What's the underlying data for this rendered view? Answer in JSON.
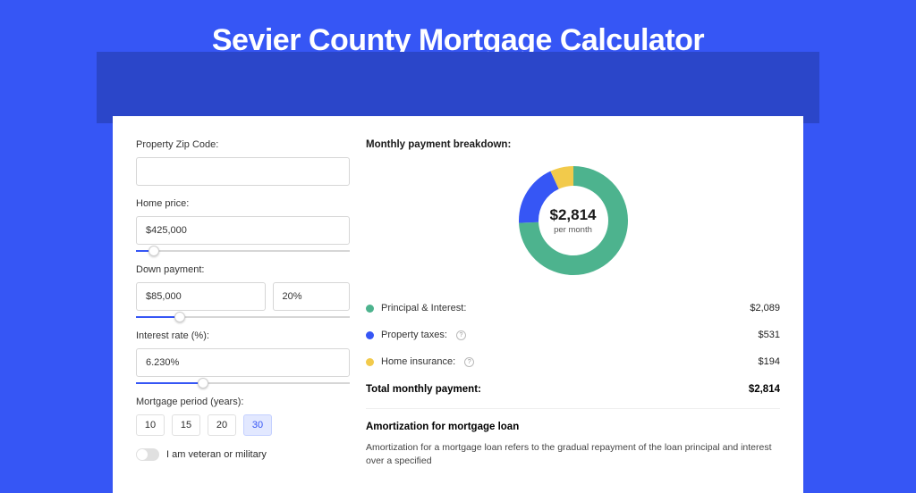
{
  "title": "Sevier County Mortgage Calculator",
  "form": {
    "zip_label": "Property Zip Code:",
    "zip_value": "",
    "price_label": "Home price:",
    "price_value": "$425,000",
    "dp_label": "Down payment:",
    "dp_amount": "$85,000",
    "dp_pct": "20%",
    "rate_label": "Interest rate (%):",
    "rate_value": "6.230%",
    "period_label": "Mortgage period (years):",
    "periods": [
      "10",
      "15",
      "20",
      "30"
    ],
    "period_selected": "30",
    "veteran_label": "I am veteran or military"
  },
  "breakdown": {
    "title": "Monthly payment breakdown:",
    "donut_amount": "$2,814",
    "donut_sub": "per month",
    "items": [
      {
        "label": "Principal & Interest:",
        "value": "$2,089",
        "color": "#4db38e",
        "help": false
      },
      {
        "label": "Property taxes:",
        "value": "$531",
        "color": "#3656f5",
        "help": true
      },
      {
        "label": "Home insurance:",
        "value": "$194",
        "color": "#f2ca4b",
        "help": true
      }
    ],
    "total_label": "Total monthly payment:",
    "total_value": "$2,814"
  },
  "amortization": {
    "title": "Amortization for mortgage loan",
    "text": "Amortization for a mortgage loan refers to the gradual repayment of the loan principal and interest over a specified"
  },
  "chart_data": {
    "type": "pie",
    "title": "Monthly payment breakdown",
    "total": 2814,
    "series": [
      {
        "name": "Principal & Interest",
        "value": 2089,
        "color": "#4db38e"
      },
      {
        "name": "Property taxes",
        "value": 531,
        "color": "#3656f5"
      },
      {
        "name": "Home insurance",
        "value": 194,
        "color": "#f2ca4b"
      }
    ]
  },
  "colors": {
    "bg": "#3656f5",
    "bg_dark": "#2b46c9",
    "green": "#4db38e",
    "blue": "#3656f5",
    "yellow": "#f2ca4b"
  }
}
